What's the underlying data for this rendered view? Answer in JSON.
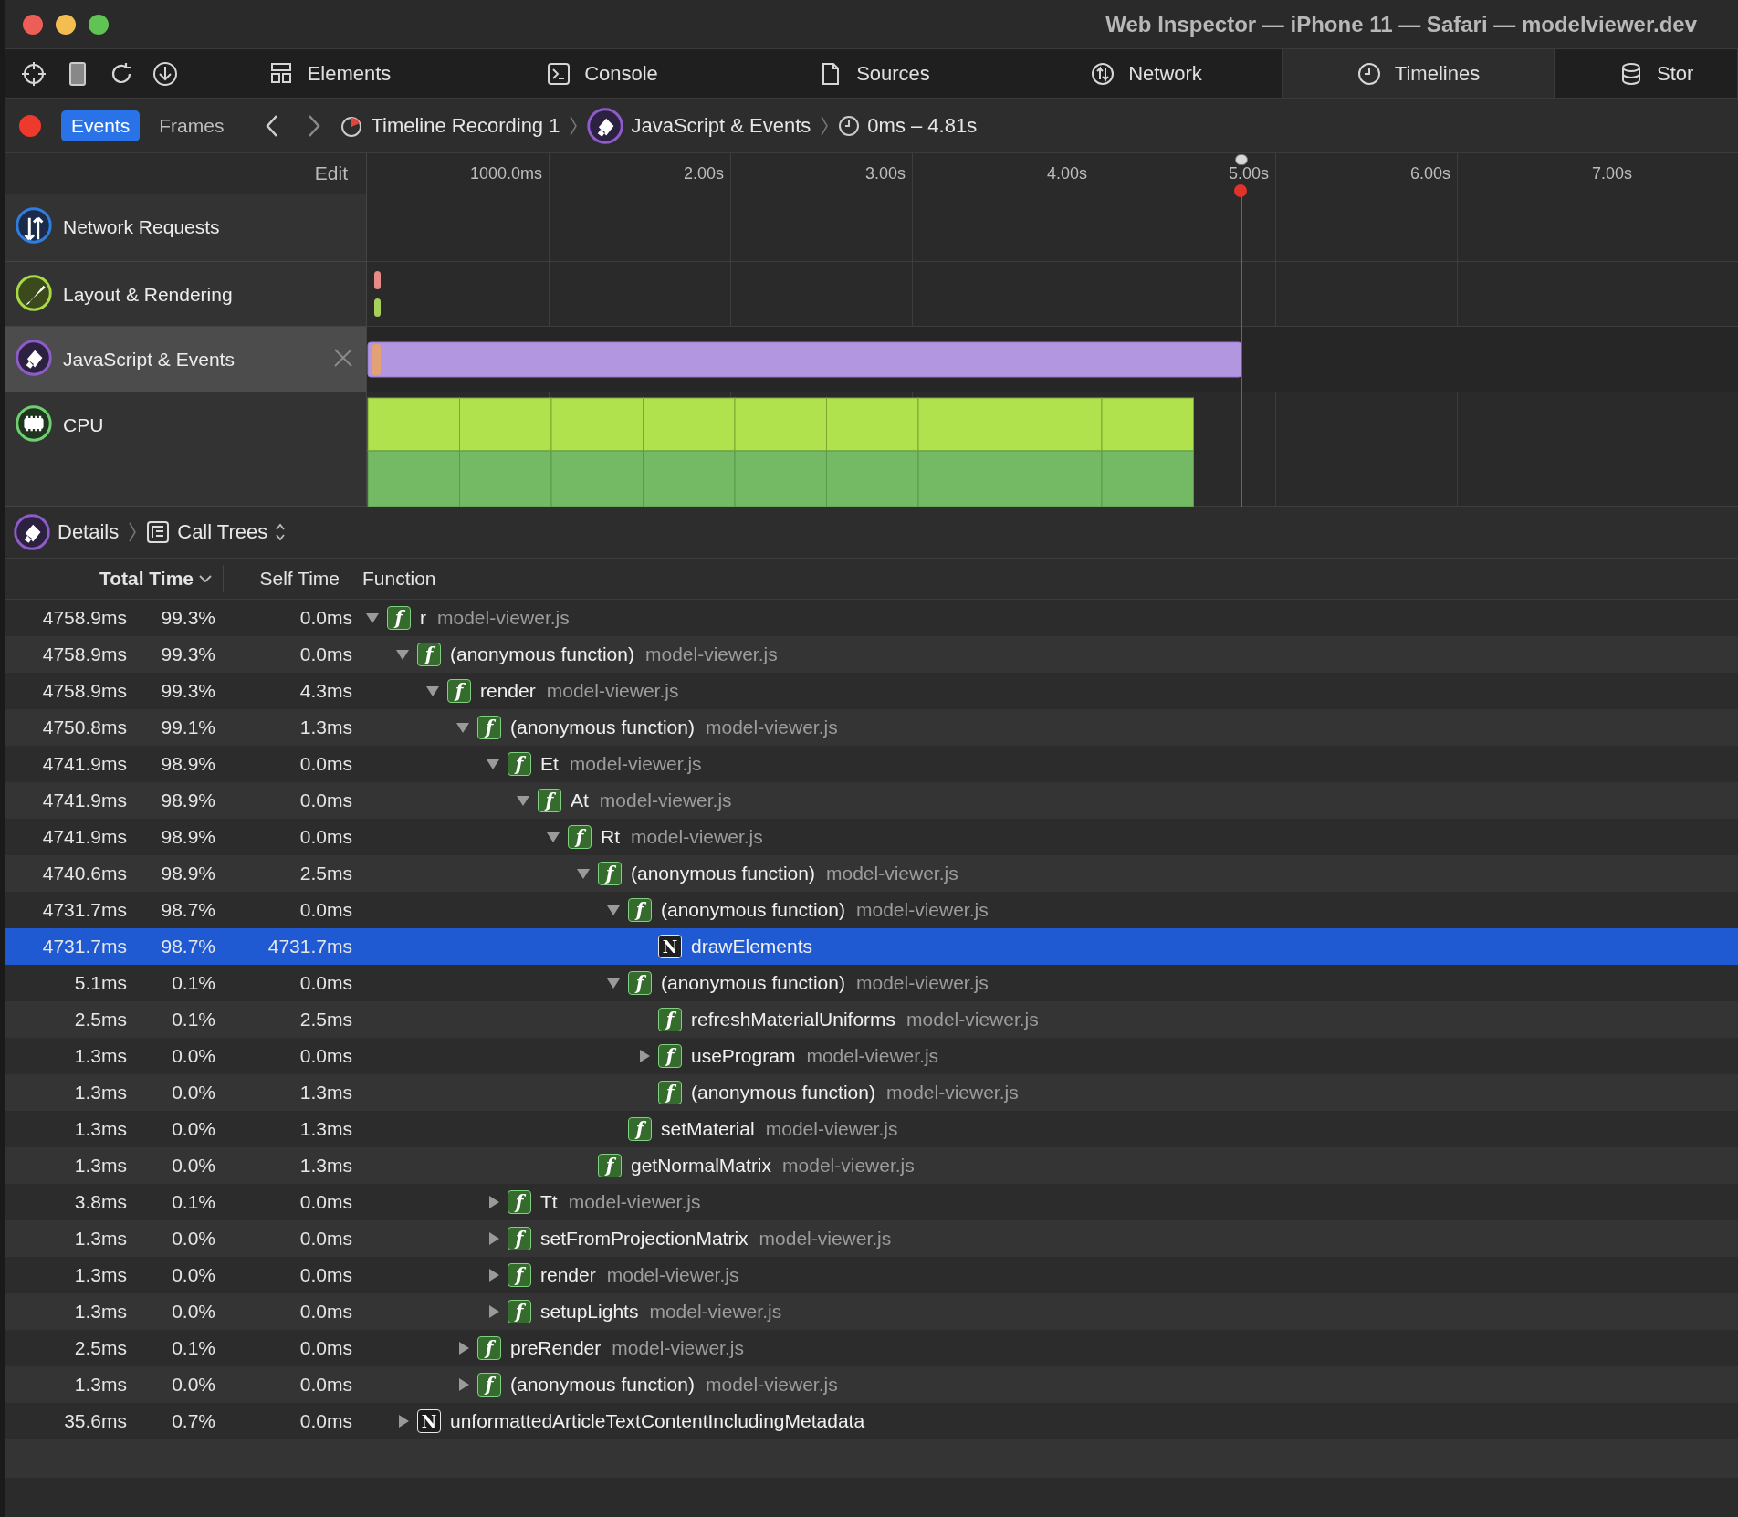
{
  "window": {
    "title": "Web Inspector — iPhone 11 — Safari — modelviewer.dev"
  },
  "tabs": [
    {
      "label": "Elements",
      "selected": false
    },
    {
      "label": "Console",
      "selected": false
    },
    {
      "label": "Sources",
      "selected": false
    },
    {
      "label": "Network",
      "selected": false
    },
    {
      "label": "Timelines",
      "selected": true
    },
    {
      "label": "Stor",
      "selected": false
    }
  ],
  "navigation": {
    "modes": [
      {
        "label": "Events",
        "selected": true
      },
      {
        "label": "Frames",
        "selected": false
      }
    ],
    "breadcrumbs": [
      "Timeline Recording 1",
      "JavaScript & Events",
      "0ms – 4.81s"
    ]
  },
  "overview": {
    "edit_label": "Edit",
    "ruler": [
      "1000.0ms",
      "2.00s",
      "3.00s",
      "4.00s",
      "5.00s",
      "6.00s",
      "7.00s"
    ],
    "tracks": [
      {
        "name": "Network Requests",
        "kind": "network",
        "selected": false
      },
      {
        "name": "Layout & Rendering",
        "kind": "layout",
        "selected": false
      },
      {
        "name": "JavaScript & Events",
        "kind": "script",
        "selected": true
      },
      {
        "name": "CPU",
        "kind": "cpu",
        "selected": false
      }
    ]
  },
  "details": {
    "breadcrumbs": [
      "Details",
      "Call Trees"
    ],
    "columns": [
      "Total Time",
      "Self Time",
      "Function"
    ],
    "rows": [
      {
        "total": "4758.9ms",
        "percent": "99.3%",
        "self": "0.0ms",
        "badge": "f",
        "name": "r",
        "file": "model-viewer.js",
        "expanded": true,
        "selected": false,
        "children": [
          {
            "total": "4758.9ms",
            "percent": "99.3%",
            "self": "0.0ms",
            "badge": "f",
            "name": "(anonymous function)",
            "file": "model-viewer.js",
            "expanded": true,
            "selected": false,
            "children": [
              {
                "total": "4758.9ms",
                "percent": "99.3%",
                "self": "4.3ms",
                "badge": "f",
                "name": "render",
                "file": "model-viewer.js",
                "expanded": true,
                "selected": false,
                "children": [
                  {
                    "total": "4750.8ms",
                    "percent": "99.1%",
                    "self": "1.3ms",
                    "badge": "f",
                    "name": "(anonymous function)",
                    "file": "model-viewer.js",
                    "expanded": true,
                    "selected": false,
                    "children": [
                      {
                        "total": "4741.9ms",
                        "percent": "98.9%",
                        "self": "0.0ms",
                        "badge": "f",
                        "name": "Et",
                        "file": "model-viewer.js",
                        "expanded": true,
                        "selected": false,
                        "children": [
                          {
                            "total": "4741.9ms",
                            "percent": "98.9%",
                            "self": "0.0ms",
                            "badge": "f",
                            "name": "At",
                            "file": "model-viewer.js",
                            "expanded": true,
                            "selected": false,
                            "children": [
                              {
                                "total": "4741.9ms",
                                "percent": "98.9%",
                                "self": "0.0ms",
                                "badge": "f",
                                "name": "Rt",
                                "file": "model-viewer.js",
                                "expanded": true,
                                "selected": false,
                                "children": [
                                  {
                                    "total": "4740.6ms",
                                    "percent": "98.9%",
                                    "self": "2.5ms",
                                    "badge": "f",
                                    "name": "(anonymous function)",
                                    "file": "model-viewer.js",
                                    "expanded": true,
                                    "selected": false,
                                    "children": [
                                      {
                                        "total": "4731.7ms",
                                        "percent": "98.7%",
                                        "self": "0.0ms",
                                        "badge": "f",
                                        "name": "(anonymous function)",
                                        "file": "model-viewer.js",
                                        "expanded": true,
                                        "selected": false,
                                        "children": [
                                          {
                                            "total": "4731.7ms",
                                            "percent": "98.7%",
                                            "self": "4731.7ms",
                                            "badge": "N",
                                            "name": "drawElements",
                                            "selected": true
                                          }
                                        ]
                                      },
                                      {
                                        "total": "5.1ms",
                                        "percent": "0.1%",
                                        "self": "0.0ms",
                                        "badge": "f",
                                        "name": "(anonymous function)",
                                        "file": "model-viewer.js",
                                        "expanded": true,
                                        "selected": false,
                                        "children": [
                                          {
                                            "total": "2.5ms",
                                            "percent": "0.1%",
                                            "self": "2.5ms",
                                            "badge": "f",
                                            "name": "refreshMaterialUniforms",
                                            "file": "model-viewer.js",
                                            "selected": false
                                          },
                                          {
                                            "total": "1.3ms",
                                            "percent": "0.0%",
                                            "self": "0.0ms",
                                            "badge": "f",
                                            "name": "useProgram",
                                            "file": "model-viewer.js",
                                            "expanded": false,
                                            "selected": false
                                          },
                                          {
                                            "total": "1.3ms",
                                            "percent": "0.0%",
                                            "self": "1.3ms",
                                            "badge": "f",
                                            "name": "(anonymous function)",
                                            "file": "model-viewer.js",
                                            "selected": false
                                          }
                                        ]
                                      },
                                      {
                                        "total": "1.3ms",
                                        "percent": "0.0%",
                                        "self": "1.3ms",
                                        "badge": "f",
                                        "name": "setMaterial",
                                        "file": "model-viewer.js",
                                        "selected": false
                                      }
                                    ]
                                  },
                                  {
                                    "total": "1.3ms",
                                    "percent": "0.0%",
                                    "self": "1.3ms",
                                    "badge": "f",
                                    "name": "getNormalMatrix",
                                    "file": "model-viewer.js",
                                    "selected": false
                                  }
                                ]
                              }
                            ]
                          }
                        ]
                      },
                      {
                        "total": "3.8ms",
                        "percent": "0.1%",
                        "self": "0.0ms",
                        "badge": "f",
                        "name": "Tt",
                        "file": "model-viewer.js",
                        "expanded": false,
                        "selected": false
                      },
                      {
                        "total": "1.3ms",
                        "percent": "0.0%",
                        "self": "0.0ms",
                        "badge": "f",
                        "name": "setFromProjectionMatrix",
                        "file": "model-viewer.js",
                        "expanded": false,
                        "selected": false
                      },
                      {
                        "total": "1.3ms",
                        "percent": "0.0%",
                        "self": "0.0ms",
                        "badge": "f",
                        "name": "render",
                        "file": "model-viewer.js",
                        "expanded": false,
                        "selected": false
                      },
                      {
                        "total": "1.3ms",
                        "percent": "0.0%",
                        "self": "0.0ms",
                        "badge": "f",
                        "name": "setupLights",
                        "file": "model-viewer.js",
                        "expanded": false,
                        "selected": false
                      }
                    ]
                  },
                  {
                    "total": "2.5ms",
                    "percent": "0.1%",
                    "self": "0.0ms",
                    "badge": "f",
                    "name": "preRender",
                    "file": "model-viewer.js",
                    "expanded": false,
                    "selected": false
                  },
                  {
                    "total": "1.3ms",
                    "percent": "0.0%",
                    "self": "0.0ms",
                    "badge": "f",
                    "name": "(anonymous function)",
                    "file": "model-viewer.js",
                    "expanded": false,
                    "selected": false
                  }
                ]
              }
            ]
          },
          {
            "total": "35.6ms",
            "percent": "0.7%",
            "self": "0.0ms",
            "badge": "N",
            "name": "unformattedArticleTextContentIncludingMetadata",
            "expanded": false,
            "selected": false
          }
        ]
      }
    ]
  }
}
